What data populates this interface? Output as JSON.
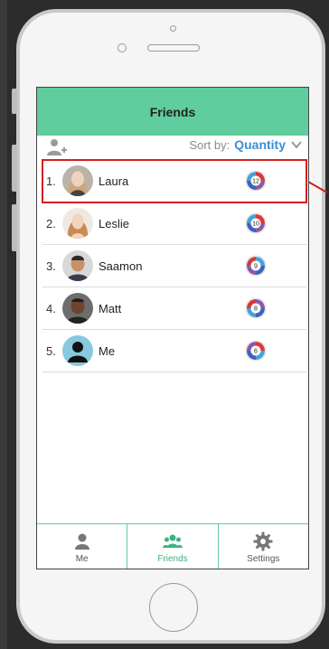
{
  "header": {
    "title": "Friends"
  },
  "toolbar": {
    "sort_label": "Sort by:",
    "sort_value": "Quantity"
  },
  "friends": [
    {
      "rank": "1.",
      "name": "Laura",
      "count": "12"
    },
    {
      "rank": "2.",
      "name": "Leslie",
      "count": "10"
    },
    {
      "rank": "3.",
      "name": "Saamon",
      "count": "9"
    },
    {
      "rank": "4.",
      "name": "Matt",
      "count": "8"
    },
    {
      "rank": "5.",
      "name": "Me",
      "count": "6"
    }
  ],
  "tabs": [
    {
      "label": "Me",
      "icon": "person-icon"
    },
    {
      "label": "Friends",
      "icon": "group-icon"
    },
    {
      "label": "Settings",
      "icon": "gear-icon"
    }
  ],
  "colors": {
    "accent": "#5fcd9d",
    "sort_value": "#3a8fd8",
    "highlight": "#d42020"
  }
}
